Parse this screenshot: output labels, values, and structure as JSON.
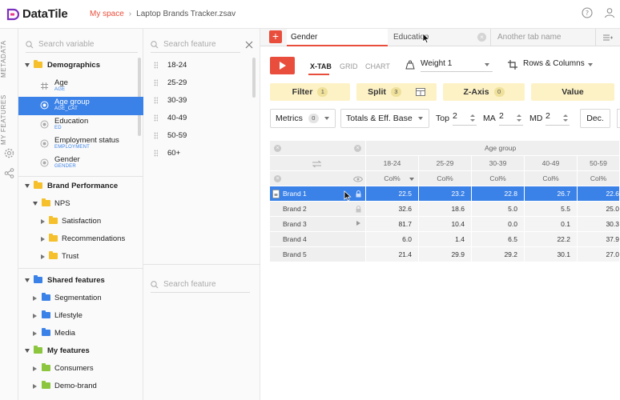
{
  "app": {
    "name": "DataTile",
    "breadcrumb": {
      "space": "My space",
      "file": "Laptop Brands Tracker.zsav"
    }
  },
  "side_tabs": {
    "metadata": "METADATA",
    "my_features": "MY FEATURES"
  },
  "variables": {
    "search_placeholder": "Search variable",
    "demographics_label": "Demographics",
    "items": [
      {
        "label": "Age",
        "code": "AGE",
        "icon": "hash-icon"
      },
      {
        "label": "Age group",
        "code": "AGE_CAT",
        "icon": "radio-icon",
        "selected": true
      },
      {
        "label": "Education",
        "code": "ED",
        "icon": "radio-icon"
      },
      {
        "label": "Employment status",
        "code": "EMPLOYMENT",
        "icon": "radio-icon"
      },
      {
        "label": "Gender",
        "code": "GENDER",
        "icon": "radio-icon"
      }
    ],
    "brand_performance": {
      "label": "Brand Performance",
      "nps": "NPS",
      "children": [
        "Satisfaction",
        "Recommendations",
        "Trust"
      ]
    },
    "shared_features": {
      "label": "Shared features",
      "children": [
        "Segmentation",
        "Lifestyle",
        "Media"
      ]
    },
    "my_features": {
      "label": "My features",
      "children": [
        "Consumers",
        "Demo-brand"
      ]
    },
    "colors": {
      "folder_yellow": "#f5c02b",
      "folder_blue": "#3b82e8",
      "folder_green": "#8cc63f"
    }
  },
  "features": {
    "search_placeholder": "Search feature",
    "items": [
      "18-24",
      "25-29",
      "30-39",
      "40-49",
      "50-59",
      "60+"
    ],
    "search2_placeholder": "Search feature"
  },
  "tabs": {
    "active": "Gender",
    "second": "Education",
    "third_placeholder": "Another tab name"
  },
  "toolbar": {
    "modes": [
      "X-TAB",
      "GRID",
      "CHART"
    ],
    "weight": "Weight 1",
    "layout": "Rows & Columns"
  },
  "chips": {
    "filter": {
      "label": "Filter",
      "count": "1"
    },
    "split": {
      "label": "Split",
      "count": "3"
    },
    "zaxis": {
      "label": "Z-Axis",
      "count": "0"
    },
    "value": {
      "label": "Value"
    }
  },
  "controls": {
    "metrics": {
      "label": "Metrics",
      "count": "0"
    },
    "totals": "Totals & Eff. Base",
    "top": {
      "label": "Top",
      "value": "2"
    },
    "ma": {
      "label": "MA",
      "value": "2"
    },
    "md": {
      "label": "MD",
      "value": "2"
    },
    "dec": "Dec."
  },
  "table": {
    "group_header": "Age group",
    "columns": [
      "18-24",
      "25-29",
      "30-39",
      "40-49",
      "50-59"
    ],
    "metric_label": "Col%",
    "rows": [
      {
        "label": "Brand 1",
        "values": [
          "22.5",
          "23.2",
          "22.8",
          "26.7",
          "22.6"
        ],
        "selected": true
      },
      {
        "label": "Brand 2",
        "values": [
          "32.6",
          "18.6",
          "5.0",
          "5.5",
          "25.0"
        ]
      },
      {
        "label": "Brand 3",
        "values": [
          "81.7",
          "10.4",
          "0.0",
          "0.1",
          "30.3"
        ]
      },
      {
        "label": "Brand 4",
        "values": [
          "6.0",
          "1.4",
          "6.5",
          "22.2",
          "37.9"
        ]
      },
      {
        "label": "Brand 5",
        "values": [
          "21.4",
          "29.9",
          "29.2",
          "30.1",
          "27.0"
        ]
      }
    ]
  },
  "accent": "#e94e3c",
  "selection": "#3b82e8"
}
